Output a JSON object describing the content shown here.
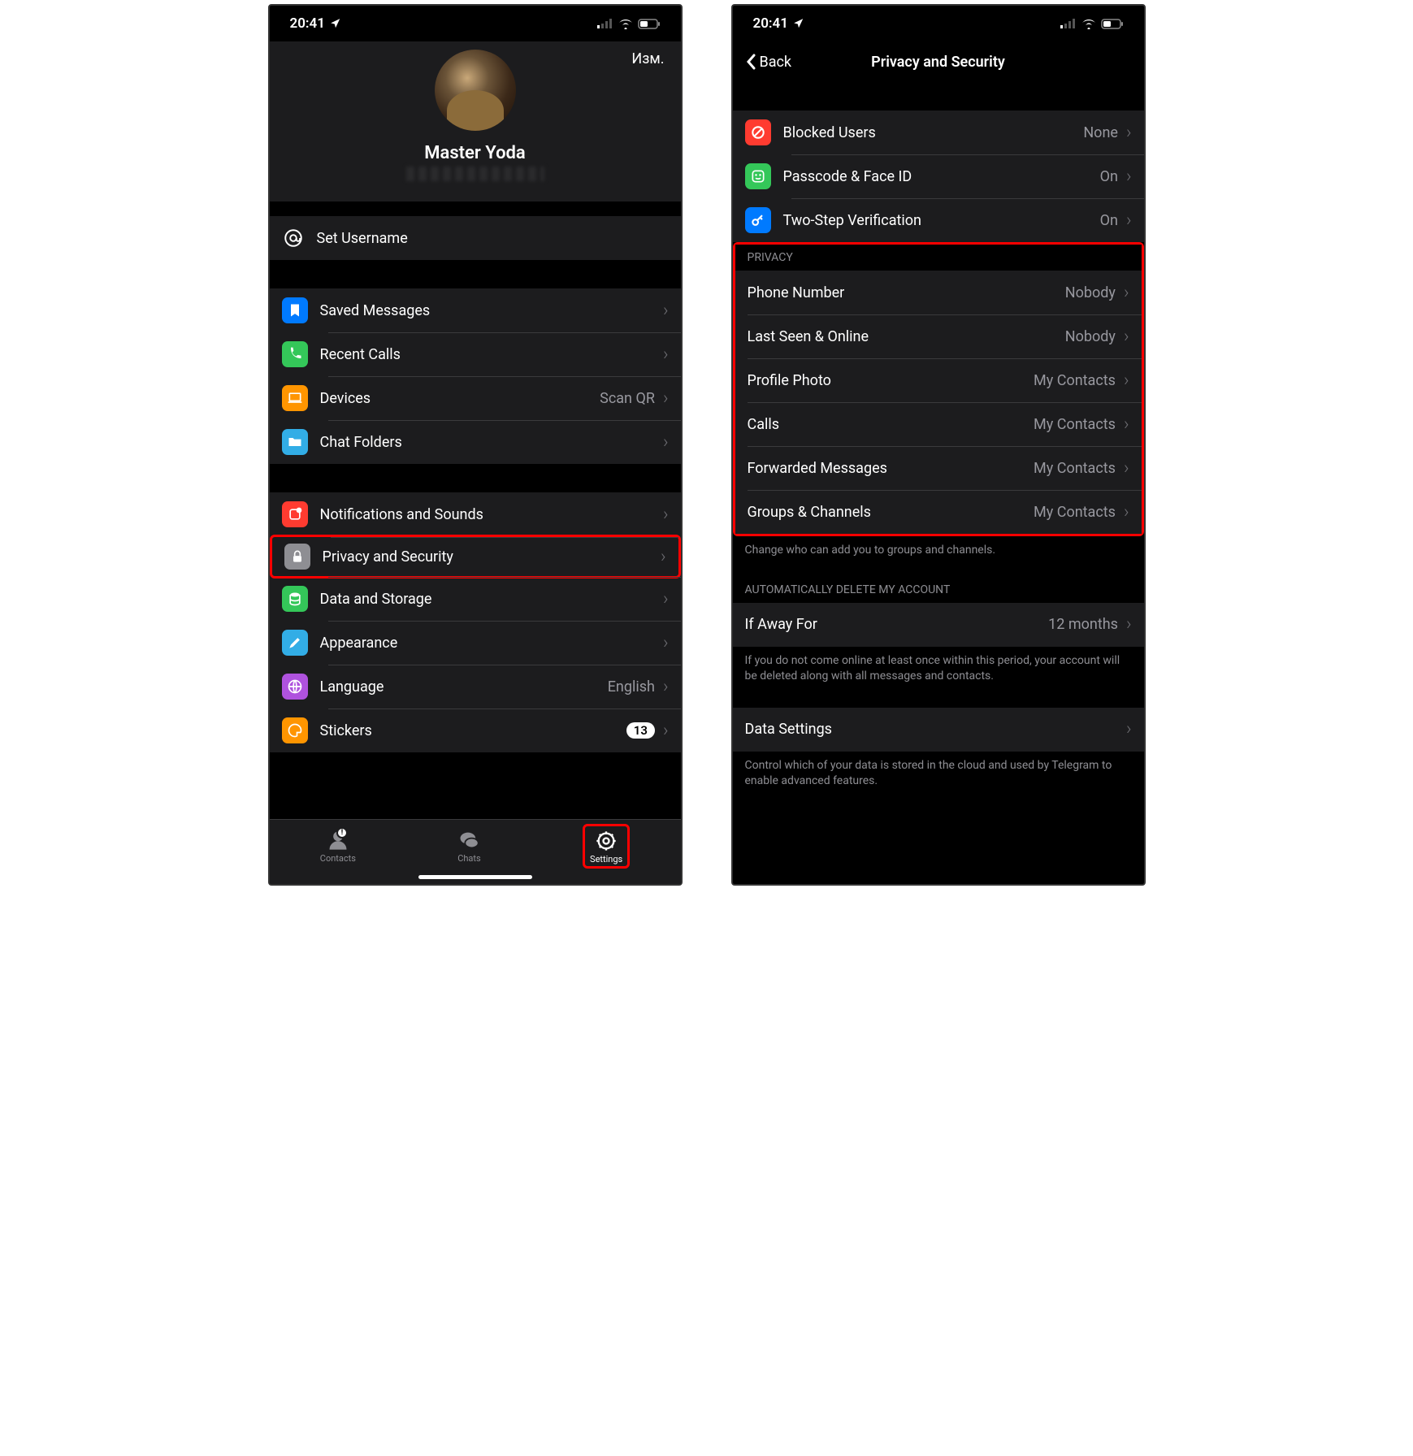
{
  "statusbar": {
    "time": "20:41"
  },
  "left": {
    "editLabel": "Изм.",
    "profileName": "Master Yoda",
    "setUsername": "Set Username",
    "group2": [
      {
        "label": "Saved Messages",
        "value": "",
        "icon": "bookmark",
        "color": "ic-blue"
      },
      {
        "label": "Recent Calls",
        "value": "",
        "icon": "phone",
        "color": "ic-green"
      },
      {
        "label": "Devices",
        "value": "Scan QR",
        "icon": "laptop",
        "color": "ic-orange"
      },
      {
        "label": "Chat Folders",
        "value": "",
        "icon": "folder",
        "color": "ic-lblue"
      }
    ],
    "group3": [
      {
        "label": "Notifications and Sounds",
        "value": "",
        "icon": "bell",
        "color": "ic-red"
      },
      {
        "label": "Privacy and Security",
        "value": "",
        "icon": "lock",
        "color": "ic-gray",
        "hl": true
      },
      {
        "label": "Data and Storage",
        "value": "",
        "icon": "db",
        "color": "ic-green"
      },
      {
        "label": "Appearance",
        "value": "",
        "icon": "brush",
        "color": "ic-lblue"
      },
      {
        "label": "Language",
        "value": "English",
        "icon": "globe",
        "color": "ic-purple"
      },
      {
        "label": "Stickers",
        "value": "",
        "badge": "13",
        "icon": "sticker",
        "color": "ic-orange"
      }
    ],
    "tabs": {
      "contacts": "Contacts",
      "chats": "Chats",
      "settings": "Settings"
    }
  },
  "right": {
    "back": "Back",
    "title": "Privacy and Security",
    "sec1": [
      {
        "label": "Blocked Users",
        "value": "None",
        "icon": "block",
        "color": "ic-red"
      },
      {
        "label": "Passcode & Face ID",
        "value": "On",
        "icon": "face",
        "color": "ic-green"
      },
      {
        "label": "Two-Step Verification",
        "value": "On",
        "icon": "key",
        "color": "ic-blue"
      }
    ],
    "privacyHeader": "PRIVACY",
    "privacy": [
      {
        "label": "Phone Number",
        "value": "Nobody"
      },
      {
        "label": "Last Seen & Online",
        "value": "Nobody"
      },
      {
        "label": "Profile Photo",
        "value": "My Contacts"
      },
      {
        "label": "Calls",
        "value": "My Contacts"
      },
      {
        "label": "Forwarded Messages",
        "value": "My Contacts"
      },
      {
        "label": "Groups & Channels",
        "value": "My Contacts"
      }
    ],
    "privacyFooter": "Change who can add you to groups and channels.",
    "autoDeleteHeader": "AUTOMATICALLY DELETE MY ACCOUNT",
    "autoDelete": {
      "label": "If Away For",
      "value": "12 months"
    },
    "autoDeleteFooter": "If you do not come online at least once within this period, your account will be deleted along with all messages and contacts.",
    "dataSettings": "Data Settings",
    "dataFooter": "Control which of your data is stored in the cloud and used by Telegram to enable advanced features."
  }
}
